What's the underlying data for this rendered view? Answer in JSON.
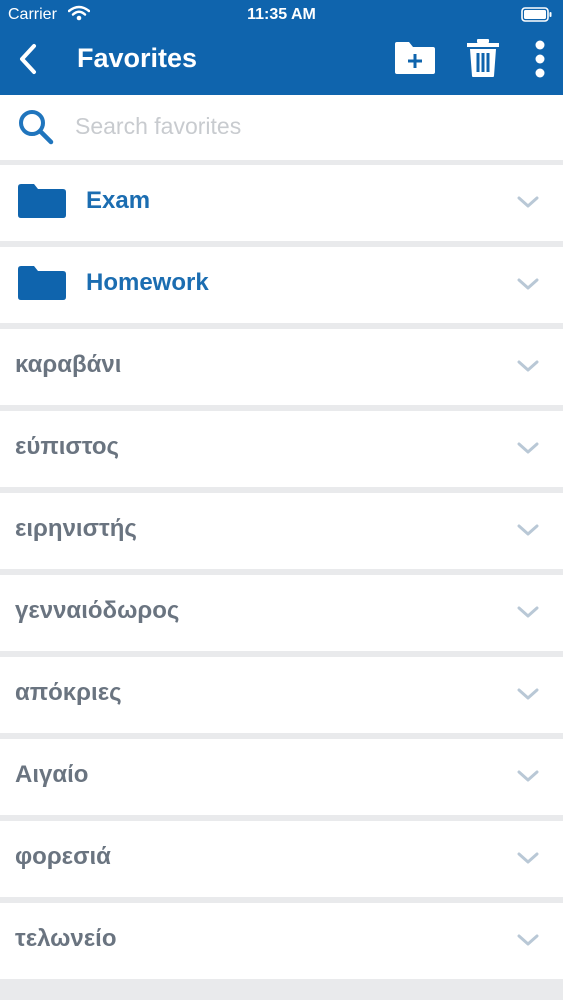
{
  "status": {
    "carrier": "Carrier",
    "time": "11:35 AM"
  },
  "navbar": {
    "title": "Favorites",
    "icons": [
      "chevron-left-icon",
      "add-folder-icon",
      "trash-icon",
      "more-vertical-icon"
    ]
  },
  "search": {
    "placeholder": "Search favorites",
    "value": ""
  },
  "folders": [
    {
      "label": "Exam"
    },
    {
      "label": "Homework"
    }
  ],
  "words": [
    {
      "label": "καραβάνι"
    },
    {
      "label": "εύπιστος"
    },
    {
      "label": "ειρηνιστής"
    },
    {
      "label": "γενναιόδωρος"
    },
    {
      "label": "απόκριες"
    },
    {
      "label": "Αιγαίο"
    },
    {
      "label": "φορεσιά"
    },
    {
      "label": "τελωνείο"
    }
  ],
  "colors": {
    "brand": "#0f64ad",
    "folder_text": "#1b6db1",
    "word_text": "#6a7480",
    "chevron": "#b9c8d6",
    "background": "#e9eaec"
  }
}
